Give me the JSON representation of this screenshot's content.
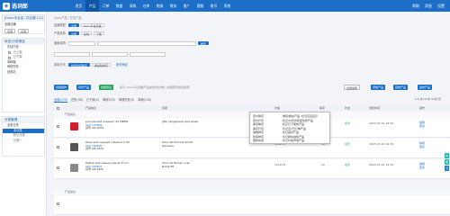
{
  "topnav": {
    "logo": "选词郎",
    "items": [
      "首页",
      "产品",
      "订单",
      "数据",
      "采购",
      "仓库",
      "物流",
      "财务",
      "推广",
      "客服",
      "账号",
      "系统"
    ],
    "right": [
      "帮助",
      "消息",
      "设置"
    ]
  },
  "sidebar": {
    "stores_title": "[Ozon平台店, 共店铺 1/1]",
    "store_name": "全部店铺",
    "store_buttons": [
      "全选",
      "反选"
    ],
    "status_title": "状态/分类筛选",
    "status_items": [
      "在线产品",
      "已上架",
      "已下架",
      "草稿箱",
      "审核失败",
      "回收站"
    ],
    "category_title": "分类管理",
    "category_items": [
      "全部分类",
      "未分类",
      "默认分类",
      "分类一"
    ]
  },
  "main": {
    "breadcrumb": "Ozon产品 / 在线产品",
    "filter": {
      "store_label": "店铺类型:",
      "store_tags": [
        "全部",
        "Ozon平台店铺"
      ],
      "status_label": "产品状态:",
      "status_tags": [
        "全部",
        "在线",
        "下架"
      ],
      "search_label": "搜索选项:",
      "search_button": "搜索",
      "sort_label": "排序方式:",
      "sort_tags": [
        "创建时间降序",
        "按编辑排序"
      ],
      "more": "更多筛选"
    },
    "toolbar": {
      "batch": "批量操作",
      "sync": "同步产品",
      "export": "批量导出",
      "notice": "提示: Ozon平台限制产品在线修改次数, 请合理安排修改频率",
      "batch_edit": "批量编辑",
      "add_product": "添加产品",
      "copy": "复制产品",
      "publish": "发布产品"
    },
    "tabs": [
      "全部(170)",
      "在售(38)",
      "已下架(4)",
      "审核中(5)",
      "审核失败(3)",
      "草稿(120)"
    ],
    "pager": "1/4  共170条  50条/页",
    "columns": [
      "产品信息",
      "标题",
      "价格",
      "库存",
      "状态",
      "创建时间",
      "操作"
    ],
    "groups": [
      "产品信息",
      "产品信息"
    ],
    "rows": [
      {
        "name": "российский элемент 20 МИНЯ",
        "sku": "SKU 154889",
        "code": "货号 OZ-1003",
        "title": "gftp продукции для дома",
        "price": "1599.00",
        "stock": "18",
        "status": "在售",
        "time": "2023-07-21 16:34",
        "actions": [
          "编辑",
          "更多"
        ],
        "color": "#d21e2b"
      },
      {
        "name": "Женский черный элемент 5 ПУ",
        "sku": "SKU 154890",
        "code": "货号 OZ-1004",
        "title": "Ozon 40 Femme Smart магазин",
        "price": "2099.75",
        "stock": "18",
        "status": "在售",
        "time": "2023-07-21 16:34",
        "actions": [
          "编辑",
          "更多"
        ],
        "color": "#555555"
      },
      {
        "name": "Набор для смены ремня 47 кл",
        "sku": "SKU 154891",
        "code": "货号 OZ-1005",
        "title": "Ozon 40 Ferrari over Nokia FR",
        "price": "1219.75",
        "stock": "10",
        "status": "在售",
        "time": "2023-07-21 16:34",
        "actions": [
          "编辑",
          "更多"
        ],
        "color": "#8a8a8a"
      }
    ],
    "popup": {
      "left": [
        "原价降序",
        "原价升序",
        "库存降序",
        "库存升序",
        "销量排序",
        "利润排序",
        "更新时间"
      ],
      "right": [
        "重复/相似产品: 标记高亮显示",
        "标记30天内有变化的产品",
        "标记已下架的产品",
        "标记近7日订单产品",
        "标记差评产品",
        "标记疑似侵权产品",
        "标记价格异常产品"
      ]
    },
    "fabs": [
      "客",
      "服",
      "顶"
    ]
  },
  "colors": {
    "brand": "#1c6ec7",
    "green": "#26a65b",
    "teal": "#1cb5a3"
  }
}
